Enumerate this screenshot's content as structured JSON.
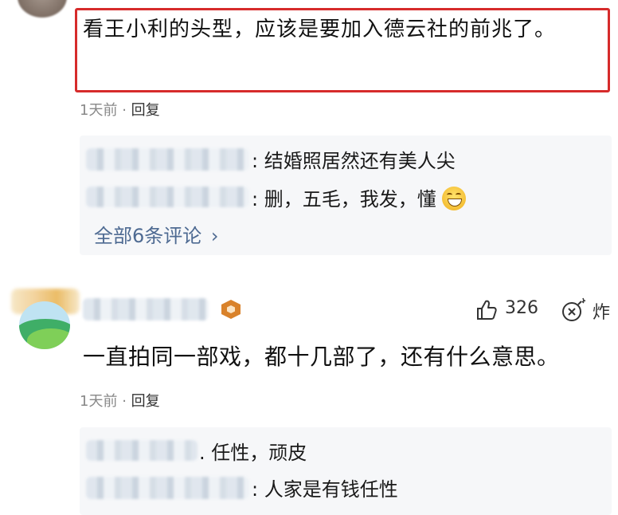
{
  "comment1": {
    "text": "看王小利的头型，应该是要加入德云社的前兆了。",
    "time": "1天前",
    "dot": "·",
    "reply_label": "回复"
  },
  "replies1": {
    "items": [
      {
        "sep": ":",
        "text": "结婚照居然还有美人尖"
      },
      {
        "sep": ":",
        "text": "删，五毛，我发，懂"
      }
    ],
    "more_label": "全部6条评论",
    "more_arrow": "›"
  },
  "comment2": {
    "likes": "326",
    "bomb_label": "炸",
    "text": "一直拍同一部戏，都十几部了，还有什么意思。",
    "time": "1天前",
    "dot": "·",
    "reply_label": "回复"
  },
  "replies2": {
    "items": [
      {
        "sep": ".",
        "text": "任性，顽皮"
      },
      {
        "sep": ":",
        "text": "人家是有钱任性"
      }
    ]
  },
  "colors": {
    "highlight_border": "#d62b2b",
    "link": "#4e6a92",
    "reply_bg": "#f6f7f9",
    "badge": "#d9822b"
  }
}
